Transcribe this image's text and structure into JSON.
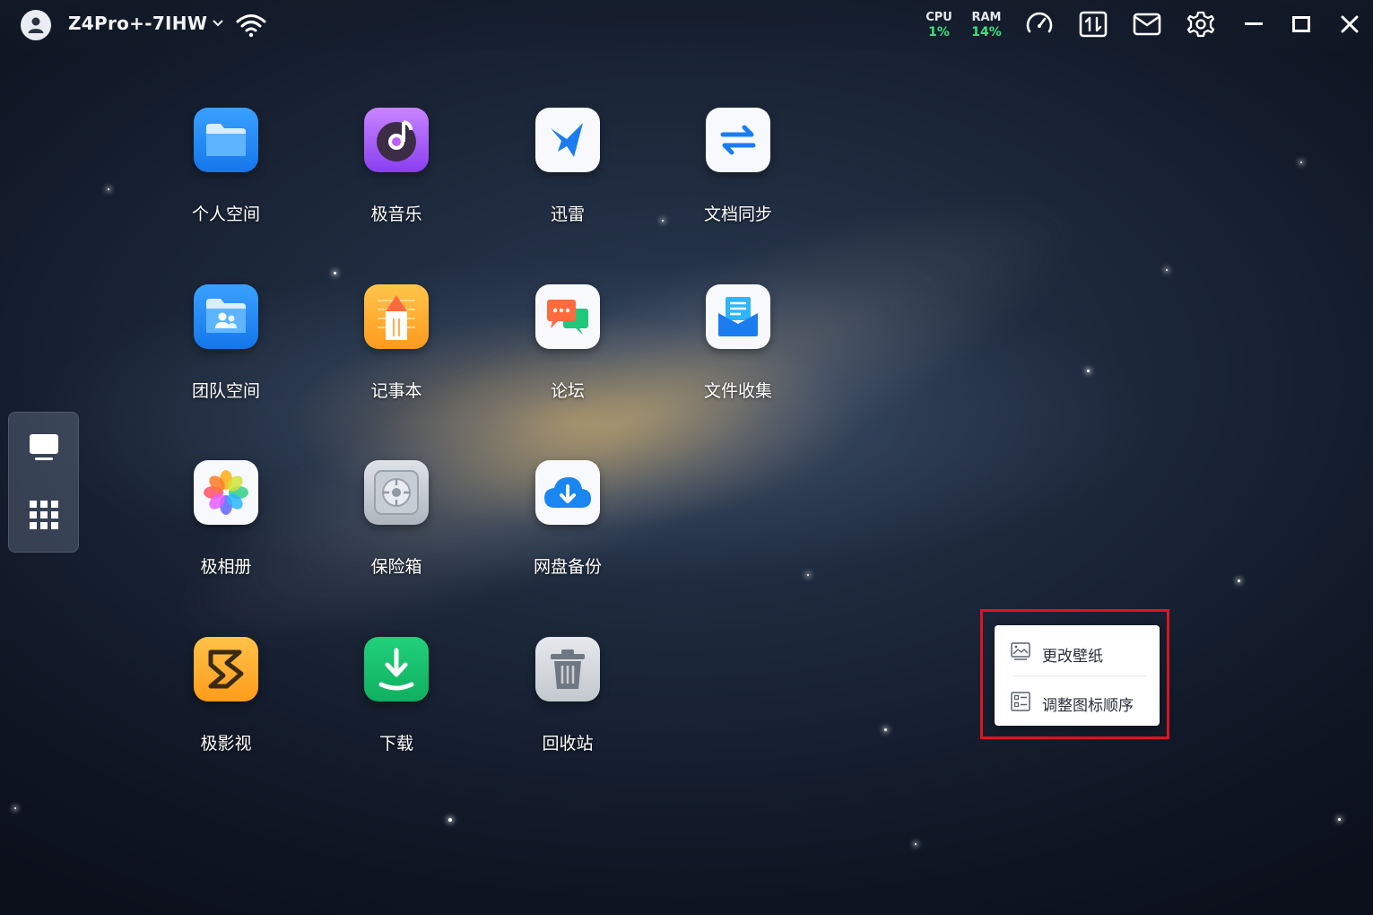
{
  "topbar": {
    "device_name": "Z4Pro+-7IHW",
    "cpu": {
      "label": "CPU",
      "value": "1%"
    },
    "ram": {
      "label": "RAM",
      "value": "14%"
    }
  },
  "apps": [
    {
      "label": "个人空间",
      "icon": "folder-icon"
    },
    {
      "label": "极音乐",
      "icon": "music-icon"
    },
    {
      "label": "迅雷",
      "icon": "thunder-bird-icon"
    },
    {
      "label": "文档同步",
      "icon": "sync-arrows-icon"
    },
    {
      "label": "团队空间",
      "icon": "team-folder-icon"
    },
    {
      "label": "记事本",
      "icon": "notepad-pencil-icon"
    },
    {
      "label": "论坛",
      "icon": "chat-bubbles-icon"
    },
    {
      "label": "文件收集",
      "icon": "inbox-file-icon"
    },
    {
      "label": "极相册",
      "icon": "photo-flower-icon"
    },
    {
      "label": "保险箱",
      "icon": "safe-icon"
    },
    {
      "label": "网盘备份",
      "icon": "cloud-download-icon"
    },
    {
      "label": "极影视",
      "icon": "video-logo-icon"
    },
    {
      "label": "下载",
      "icon": "download-icon"
    },
    {
      "label": "回收站",
      "icon": "trash-icon"
    }
  ],
  "context_menu": {
    "items": [
      {
        "label": "更改壁纸",
        "icon": "wallpaper-icon"
      },
      {
        "label": "调整图标顺序",
        "icon": "reorder-icon"
      }
    ]
  },
  "colors": {
    "stat_value": "#3fe07b",
    "highlight_border": "#e0141e"
  }
}
